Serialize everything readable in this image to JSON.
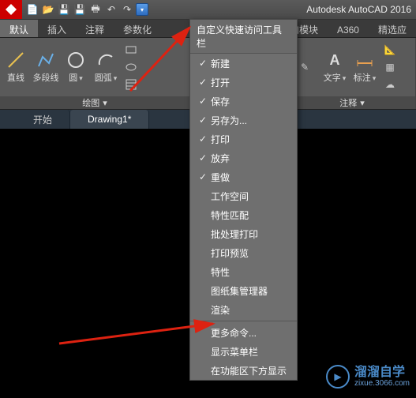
{
  "title": "Autodesk AutoCAD 2016",
  "qat_icons": [
    "new-icon",
    "open-icon",
    "save-icon",
    "saveas-icon",
    "print-icon",
    "undo-icon",
    "redo-icon"
  ],
  "ribbon": {
    "tabs": [
      {
        "label": "默认",
        "active": true
      },
      {
        "label": "插入"
      },
      {
        "label": "注释"
      },
      {
        "label": "参数化"
      },
      {
        "label": "附加模块"
      },
      {
        "label": "A360"
      },
      {
        "label": "精选应"
      }
    ],
    "panel_draw": {
      "title": "绘图",
      "tools": [
        {
          "label": "直线"
        },
        {
          "label": "多段线"
        },
        {
          "label": "圆"
        },
        {
          "label": "圆弧"
        }
      ]
    },
    "panel_annotate": {
      "title": "注释",
      "tools": [
        {
          "label": "文字"
        },
        {
          "label": "标注"
        }
      ]
    }
  },
  "doc_tabs": [
    {
      "label": "开始"
    },
    {
      "label": "Drawing1*",
      "active": true
    }
  ],
  "dropdown": {
    "header": "自定义快速访问工具栏",
    "items": [
      {
        "label": "新建",
        "checked": true
      },
      {
        "label": "打开",
        "checked": true
      },
      {
        "label": "保存",
        "checked": true
      },
      {
        "label": "另存为...",
        "checked": true
      },
      {
        "label": "打印",
        "checked": true
      },
      {
        "label": "放弃",
        "checked": true
      },
      {
        "label": "重做",
        "checked": true
      },
      {
        "label": "工作空间",
        "checked": false
      },
      {
        "label": "特性匹配",
        "checked": false
      },
      {
        "label": "批处理打印",
        "checked": false
      },
      {
        "label": "打印预览",
        "checked": false
      },
      {
        "label": "特性",
        "checked": false
      },
      {
        "label": "图纸集管理器",
        "checked": false
      },
      {
        "label": "渲染",
        "checked": false
      }
    ],
    "footer": [
      {
        "label": "更多命令..."
      },
      {
        "label": "显示菜单栏"
      },
      {
        "label": "在功能区下方显示"
      }
    ]
  },
  "watermark": {
    "main": "溜溜自学",
    "sub": "zixue.3066.com"
  }
}
